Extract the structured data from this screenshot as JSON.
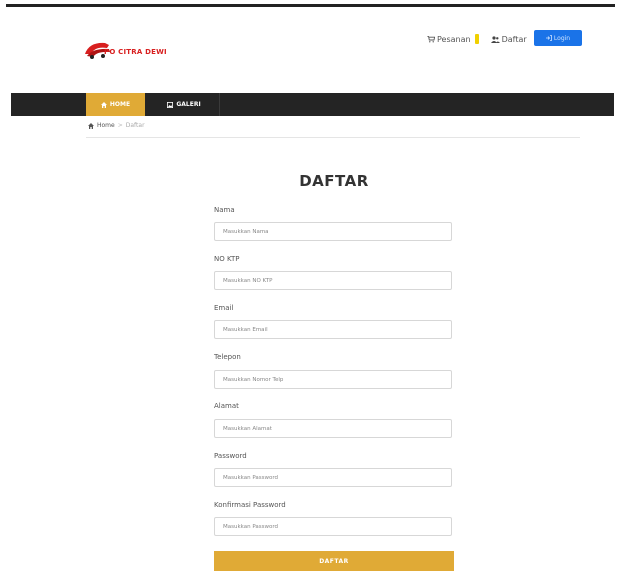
{
  "header": {
    "logo_text": "PO CITRA DEWI",
    "cart_label": "Pesanan",
    "register_link": "Daftar",
    "login_label": "Login"
  },
  "nav": {
    "items": [
      {
        "label": "HOME",
        "icon": "home-icon"
      },
      {
        "label": "GALERI",
        "icon": "image-icon"
      }
    ]
  },
  "breadcrumb": {
    "home": "Home",
    "current": "Daftar"
  },
  "form": {
    "title": "DAFTAR",
    "fields": [
      {
        "label": "Nama",
        "placeholder": "Masukkan Nama"
      },
      {
        "label": "NO KTP",
        "placeholder": "Masukkan NO KTP"
      },
      {
        "label": "Email",
        "placeholder": "Masukkan Email"
      },
      {
        "label": "Telepon",
        "placeholder": "Masukkan Nomor Telp"
      },
      {
        "label": "Alamat",
        "placeholder": "Masukkan Alamat"
      },
      {
        "label": "Password",
        "placeholder": "Masukkan Password"
      },
      {
        "label": "Konfirmasi Password",
        "placeholder": "Masukkan Password"
      }
    ],
    "submit_label": "DAFTAR"
  },
  "colors": {
    "accent": "#e0aa36",
    "navbar": "#242424",
    "login_button": "#1a73e8",
    "cart_badge": "#f0d000",
    "logo_red": "#d81f1f"
  }
}
